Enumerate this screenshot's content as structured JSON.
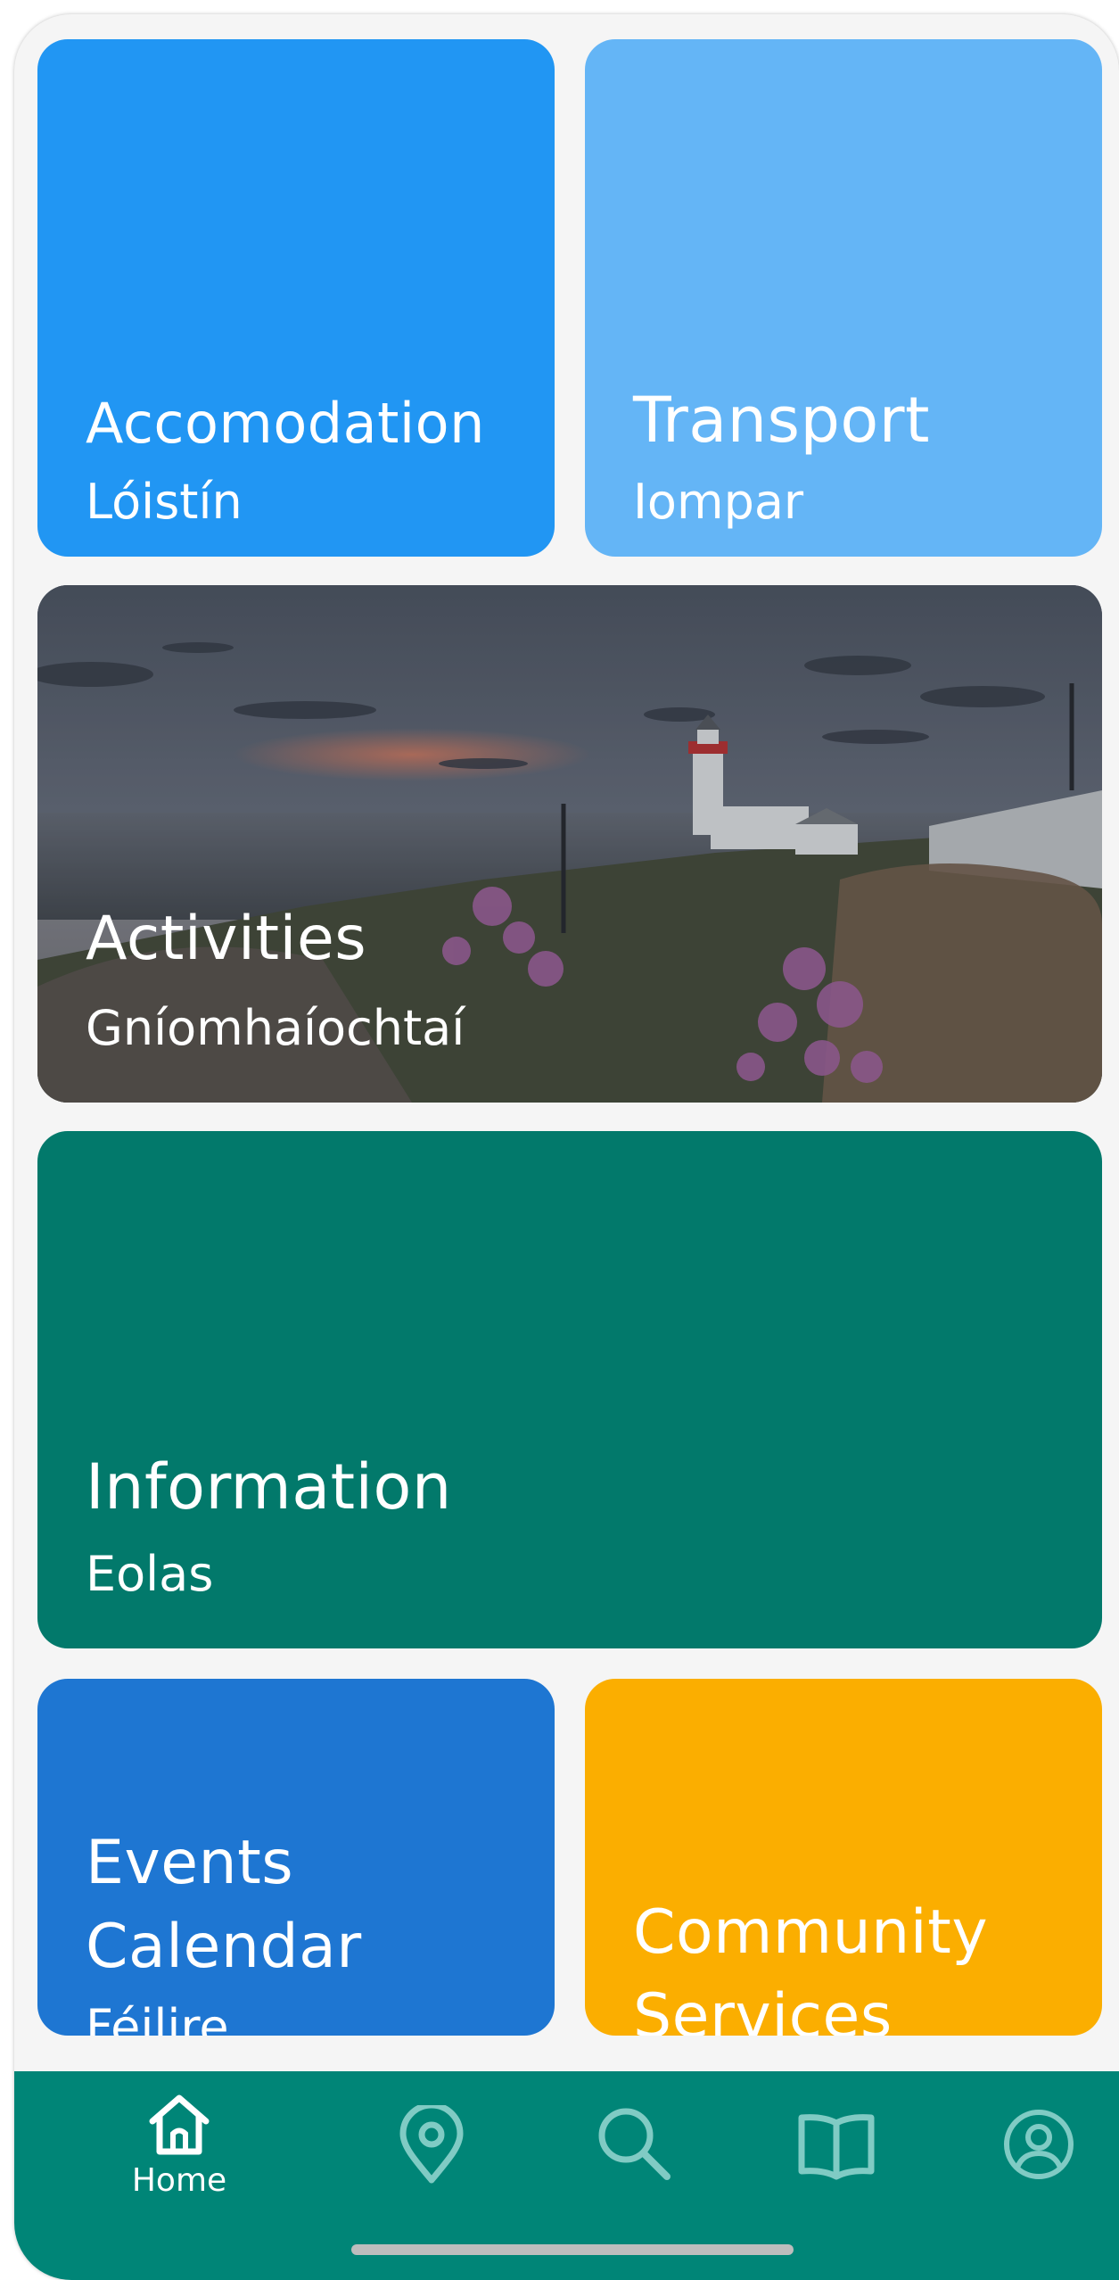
{
  "tiles": {
    "accommodation": {
      "title": "Accomodation",
      "subtitle": "Lóistín",
      "color": "#2196f3"
    },
    "transport": {
      "title": "Transport",
      "subtitle": "Iompar",
      "color": "#64b5f6"
    },
    "activities": {
      "title": "Activities",
      "subtitle": "Gníomhaíochtaí",
      "image": "lighthouse coastal sunset photo"
    },
    "information": {
      "title": "Information",
      "subtitle": "Eolas",
      "color": "#02796b"
    },
    "events": {
      "title": "Events Calendar",
      "subtitle": "Féilire",
      "color": "#1e76d2"
    },
    "community": {
      "title": "Community Services",
      "color": "#fbae00"
    }
  },
  "bottom_nav": {
    "items": [
      {
        "icon": "home-icon",
        "label": "Home",
        "active": true
      },
      {
        "icon": "map-pin-icon"
      },
      {
        "icon": "search-icon"
      },
      {
        "icon": "book-icon"
      },
      {
        "icon": "account-icon"
      }
    ],
    "color": "#008577",
    "active_color": "#ffffff",
    "inactive_color": "#80cbc4"
  }
}
